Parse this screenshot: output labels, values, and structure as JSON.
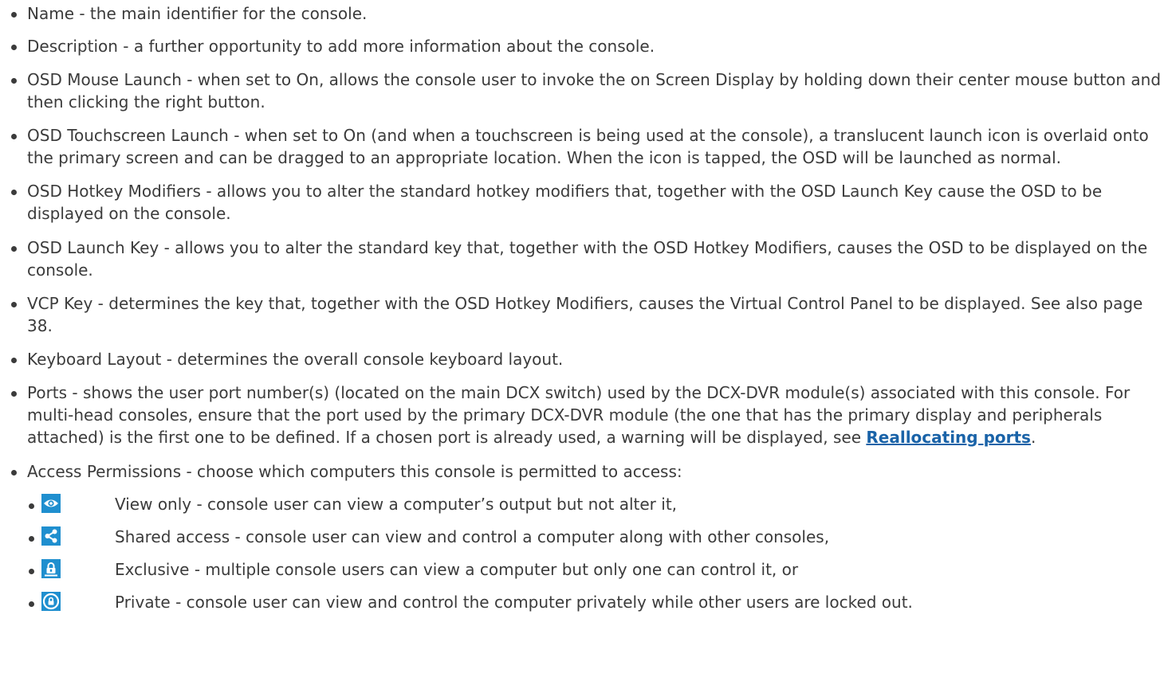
{
  "items": [
    {
      "text": "Name - the main identifier for the console."
    },
    {
      "text": "Description - a further opportunity to add more information about the console."
    },
    {
      "text": "OSD Mouse Launch - when set to On, allows the console user to invoke the on Screen Display by holding down their center mouse button and then clicking the right button."
    },
    {
      "text": "OSD Touchscreen Launch - when set to On (and when a touchscreen is being used at the console), a translucent launch icon is overlaid onto the primary screen and can be dragged to an appropriate location. When the icon is tapped, the OSD will be launched as normal."
    },
    {
      "text": "OSD Hotkey Modifiers - allows you to alter the standard hotkey modifiers that, together with the OSD Launch Key cause the OSD to be displayed on the console."
    },
    {
      "text": "OSD Launch Key - allows you to alter the standard key that, together with the OSD Hotkey Modifiers, causes the OSD to be displayed on the console."
    },
    {
      "text": "VCP Key - determines the key that, together with the OSD Hotkey Modifiers, causes the Virtual Control Panel to be displayed. See also page 38."
    },
    {
      "text": "Keyboard Layout - determines the overall console keyboard layout."
    },
    {
      "text": "Ports - shows the user port number(s) (located on the main DCX switch) used by the DCX-DVR module(s) associated with this console. For multi-head consoles, ensure that the port used by the primary DCX-DVR module (the one that has the primary display and peripherals attached) is the first one to be defined. If a chosen port is already used, a warning will be displayed, see ",
      "link": "Reallocating ports",
      "after": "."
    },
    {
      "text": "Access Permissions - choose which computers this console is permitted to access:"
    }
  ],
  "permissions": [
    {
      "icon": "eye-icon",
      "text": "View only - console user can view a computer’s output but not alter it,"
    },
    {
      "icon": "share-icon",
      "text": "Shared access - console user can view and control a computer along with other consoles,"
    },
    {
      "icon": "exclusive-lock-icon",
      "text": "Exclusive - multiple console users can view a computer but only one can control it, or"
    },
    {
      "icon": "private-lock-icon",
      "text": "Private - console user can view and control the computer privately while other users are locked out."
    }
  ],
  "colors": {
    "text": "#3b3b3b",
    "link": "#1a63a8",
    "icon_bg": "#1f8fcf"
  }
}
